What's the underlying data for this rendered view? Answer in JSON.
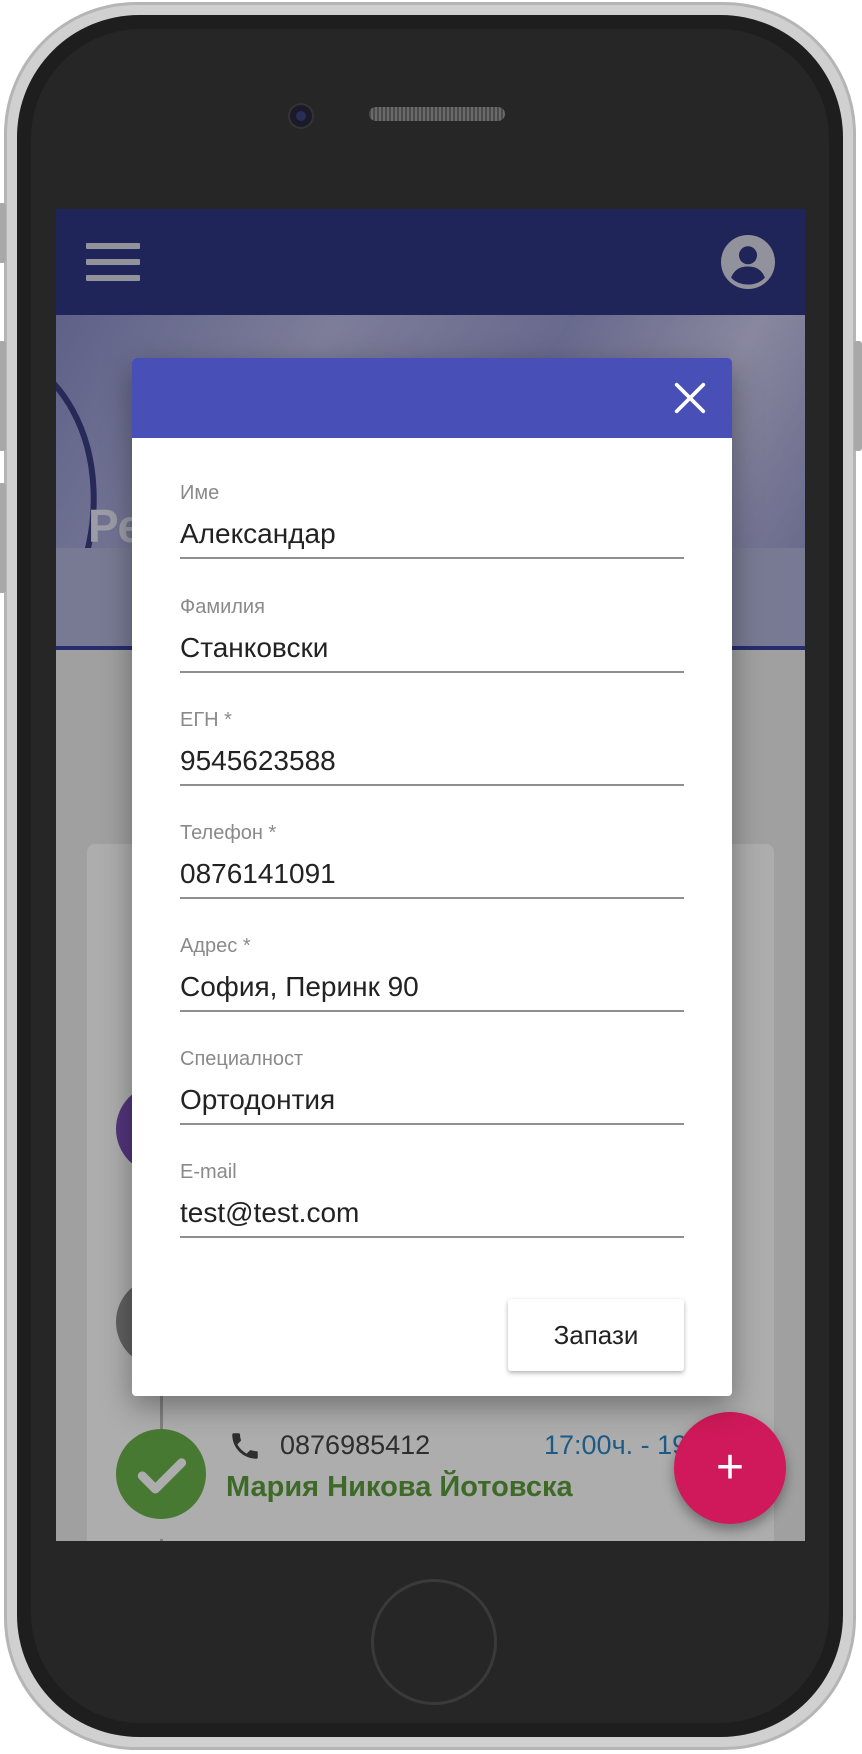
{
  "app": {
    "hero_title": "Ре"
  },
  "background_list": {
    "appointment": {
      "phone": "0876985412",
      "time": "17:00ч. - 19",
      "name": "Мария Никова Йотовска"
    }
  },
  "form": {
    "fields": [
      {
        "label": "Име",
        "value": "Александар"
      },
      {
        "label": "Фамилия",
        "value": "Станковски"
      },
      {
        "label": "ЕГН *",
        "value": "9545623588"
      },
      {
        "label": "Телефон *",
        "value": "0876141091"
      },
      {
        "label": "Адрес *",
        "value": "София, Перинк 90"
      },
      {
        "label": "Специалност",
        "value": "Ортодонтия"
      },
      {
        "label": "E-mail",
        "value": "test@test.com"
      }
    ],
    "save_label": "Запази"
  },
  "fab": {
    "label": "+"
  },
  "colors": {
    "appbar": "#2e3584",
    "dialog_header": "#484fb7",
    "fab": "#d0195a",
    "appt_done": "#5a9c3a",
    "appt_time": "#2c86c8"
  },
  "icons": {
    "menu": "menu-icon",
    "account": "account-circle-icon",
    "close": "close-icon",
    "phone": "phone-icon",
    "check": "check-icon",
    "add": "plus-icon"
  }
}
